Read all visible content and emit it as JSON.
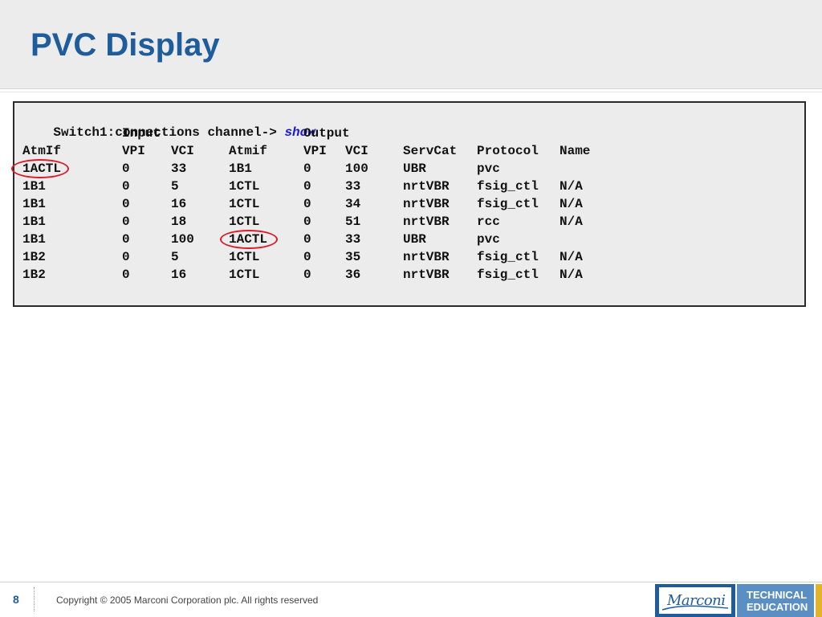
{
  "slide": {
    "title": "PVC Display"
  },
  "terminal": {
    "prompt": "Switch1:connections channel-> ",
    "command": "show",
    "group_headers": {
      "input": "Input",
      "output": "Output"
    },
    "columns": [
      "AtmIf",
      "VPI",
      "VCI",
      "Atmif",
      "VPI",
      "VCI",
      "ServCat",
      "Protocol",
      "Name"
    ],
    "rows": [
      [
        "1ACTL",
        "0",
        "33",
        "1B1",
        "0",
        "100",
        "UBR",
        "pvc",
        ""
      ],
      [
        "1B1",
        "0",
        "5",
        "1CTL",
        "0",
        "33",
        "nrtVBR",
        "fsig_ctl",
        "N/A"
      ],
      [
        "1B1",
        "0",
        "16",
        "1CTL",
        "0",
        "34",
        "nrtVBR",
        "fsig_ctl",
        "N/A"
      ],
      [
        "1B1",
        "0",
        "18",
        "1CTL",
        "0",
        "51",
        "nrtVBR",
        "rcc",
        "N/A"
      ],
      [
        "1B1",
        "0",
        "100",
        "1ACTL",
        "0",
        "33",
        "UBR",
        "pvc",
        ""
      ],
      [
        "1B2",
        "0",
        "5",
        "1CTL",
        "0",
        "35",
        "nrtVBR",
        "fsig_ctl",
        "N/A"
      ],
      [
        "1B2",
        "0",
        "16",
        "1CTL",
        "0",
        "36",
        "nrtVBR",
        "fsig_ctl",
        "N/A"
      ]
    ],
    "highlight_color": "#d81e2c",
    "command_color": "#1a1acc"
  },
  "footer": {
    "page_number": "8",
    "copyright": "Copyright © 2005 Marconi Corporation plc. All rights reserved",
    "logo_text": "Marconi",
    "badge_line1": "TECHNICAL",
    "badge_line2": "EDUCATION",
    "brand_blue": "#1f5c9c",
    "accent_gold": "#e3b32a"
  }
}
